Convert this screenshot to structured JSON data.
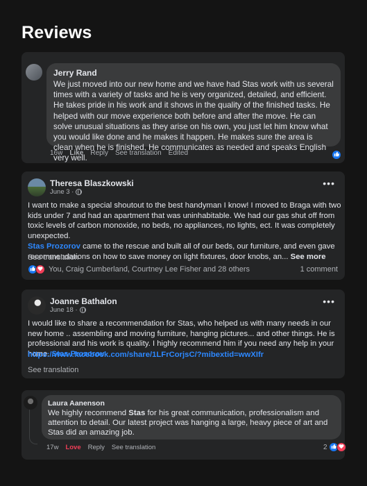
{
  "page": {
    "title": "Reviews"
  },
  "review1": {
    "author": "Jerry Rand",
    "text": "We just moved into our new home and we have had Stas work with us several times with a variety of tasks and he is very organized, detailed, and efficient. He takes pride in his work and it shows in the quality of the finished tasks. He helped with our move experience both before and after the move. He can solve unusual situations as they arise on his own, you just let him know what you would like done and he makes it happen. He makes sure the area is clean when he is finished. He communicates as needed and speaks English very well.",
    "time": "16w",
    "like_label": "Like",
    "reply_label": "Reply",
    "translate_label": "See translation",
    "edited_label": "Edited",
    "reaction_icon": "like-icon"
  },
  "review2": {
    "author": "Theresa Blaszkowski",
    "date": "June 3 ·",
    "more_icon": "•••",
    "text_part1": "I want to make a special shoutout to the best handyman I know! I moved to Braga with two kids under 7 and had an apartment that was uninhabitable. We had our gas shut off from toxic levels of carbon monoxide, no beds, no appliances, no lights, ect. It was completely unexpected.",
    "mention": "Stas Prozorov",
    "text_part2": " came to the rescue and built all of our beds, our furniture, and even gave recommendations on how to save money on light fixtures, door knobs, an...",
    "see_more": "See more",
    "translate_label": "See translation",
    "reaction_names": "You, Craig Cumberland, Courtney Lee Fisher and 28 others",
    "comment_count": "1 comment"
  },
  "review3": {
    "author": "Joanne Bathalon",
    "date": "June 18 ·",
    "more_icon": "•••",
    "text": "I would like to share a recommendation for Stas, who helped us with many needs in our new home .. assembling and moving furniture, hanging pictures... and other things. He is professional and his work is quality.  I highly recommend him if you need any help in your home.  ",
    "mention": "Stas Prozorov",
    "url": "https://www.facebook.com/share/1LFrCorjsC/?mibextid=wwXIfr",
    "translate_label": "See translation"
  },
  "review4": {
    "author": "Laura Aanenson",
    "text_before": "We highly recommend ",
    "text_bold": "Stas",
    "text_after": " for his great communication, professionalism and attention to detail. Our latest project was hanging a large, heavy piece of art and Stas did an amazing job.",
    "time": "17w",
    "love_label": "Love",
    "reply_label": "Reply",
    "translate_label": "See translation",
    "reaction_count": "2"
  },
  "colors": {
    "background": "#141414",
    "card": "#242526",
    "bubble": "#3a3b3c",
    "link": "#2d88ff",
    "like": "#1877f2",
    "love": "#f33e58"
  }
}
